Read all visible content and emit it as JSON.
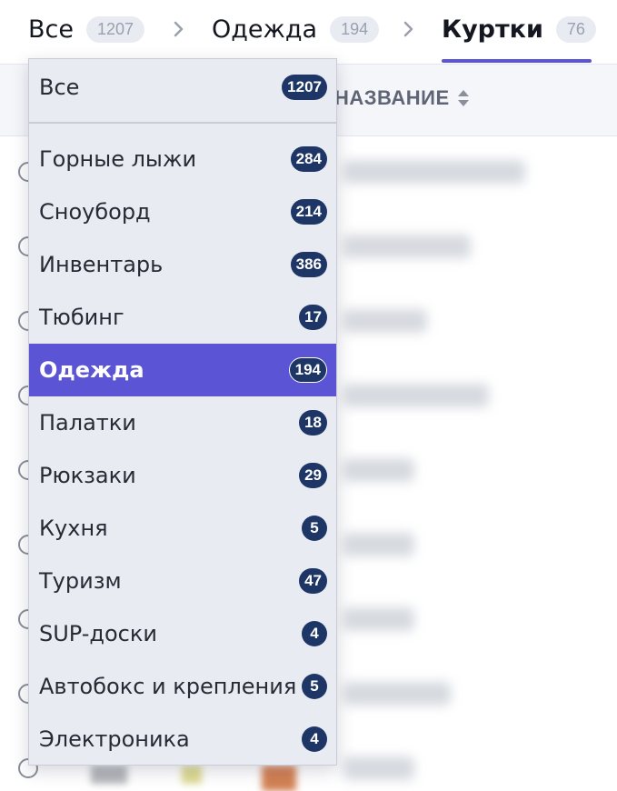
{
  "breadcrumb": {
    "items": [
      {
        "label": "Все",
        "count": "1207"
      },
      {
        "label": "Одежда",
        "count": "194"
      },
      {
        "label": "Куртки",
        "count": "76"
      }
    ]
  },
  "table": {
    "name_column": "НАЗВАНИЕ"
  },
  "dropdown": {
    "all": {
      "label": "Все",
      "count": "1207"
    },
    "items": [
      {
        "label": "Горные лыжи",
        "count": "284"
      },
      {
        "label": "Сноуборд",
        "count": "214"
      },
      {
        "label": "Инвентарь",
        "count": "386"
      },
      {
        "label": "Тюбинг",
        "count": "17"
      },
      {
        "label": "Одежда",
        "count": "194"
      },
      {
        "label": "Палатки",
        "count": "18"
      },
      {
        "label": "Рюкзаки",
        "count": "29"
      },
      {
        "label": "Кухня",
        "count": "5"
      },
      {
        "label": "Туризм",
        "count": "47"
      },
      {
        "label": "SUP-доски",
        "count": "4"
      },
      {
        "label": "Автобокс и крепления",
        "count": "5"
      },
      {
        "label": "Электроника",
        "count": "4"
      }
    ],
    "selected_index": 4
  },
  "colors": {
    "accent": "#5b55d6",
    "badge": "#1d3666",
    "dropdown_bg": "#e9ebf3"
  }
}
